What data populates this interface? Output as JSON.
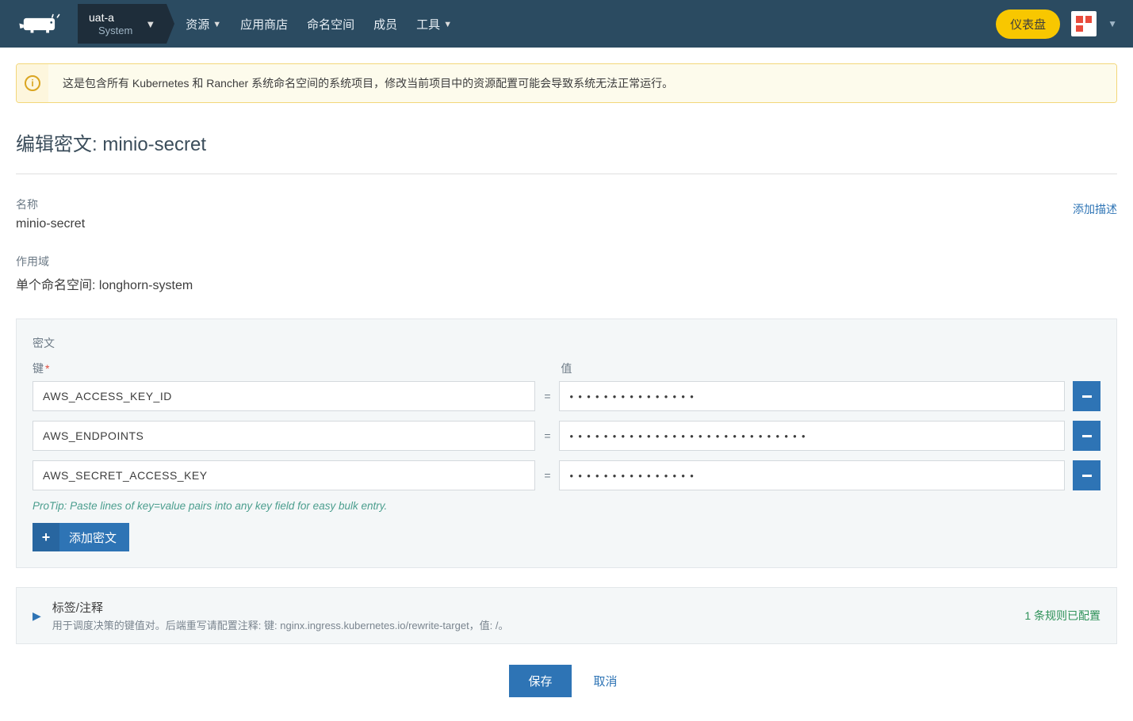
{
  "header": {
    "cluster_name": "uat-a",
    "cluster_sub": "System",
    "nav": {
      "resources": "资源",
      "apps": "应用商店",
      "namespaces": "命名空间",
      "members": "成员",
      "tools": "工具"
    },
    "dashboard": "仪表盘"
  },
  "alert": {
    "text": "这是包含所有 Kubernetes 和 Rancher 系统命名空间的系统项目，修改当前项目中的资源配置可能会导致系统无法正常运行。"
  },
  "page": {
    "title": "编辑密文: minio-secret",
    "name_label": "名称",
    "name_value": "minio-secret",
    "add_description": "添加描述",
    "scope_label": "作用域",
    "scope_value": "单个命名空间: longhorn-system"
  },
  "secrets": {
    "panel_title": "密文",
    "key_label": "键",
    "value_label": "值",
    "rows": [
      {
        "key": "AWS_ACCESS_KEY_ID",
        "value": "●●●●●●●●●●●●●●●"
      },
      {
        "key": "AWS_ENDPOINTS",
        "value": "●●●●●●●●●●●●●●●●●●●●●●●●●●●●"
      },
      {
        "key": "AWS_SECRET_ACCESS_KEY",
        "value": "●●●●●●●●●●●●●●●"
      }
    ],
    "protip": "ProTip: Paste lines of key=value pairs into any key field for easy bulk entry.",
    "add_button": "添加密文"
  },
  "labels": {
    "title": "标签/注释",
    "subtitle": "用于调度决策的键值对。后端重写请配置注释: 键: nginx.ingress.kubernetes.io/rewrite-target，值: /。",
    "badge": "1 条规则已配置"
  },
  "actions": {
    "save": "保存",
    "cancel": "取消"
  }
}
